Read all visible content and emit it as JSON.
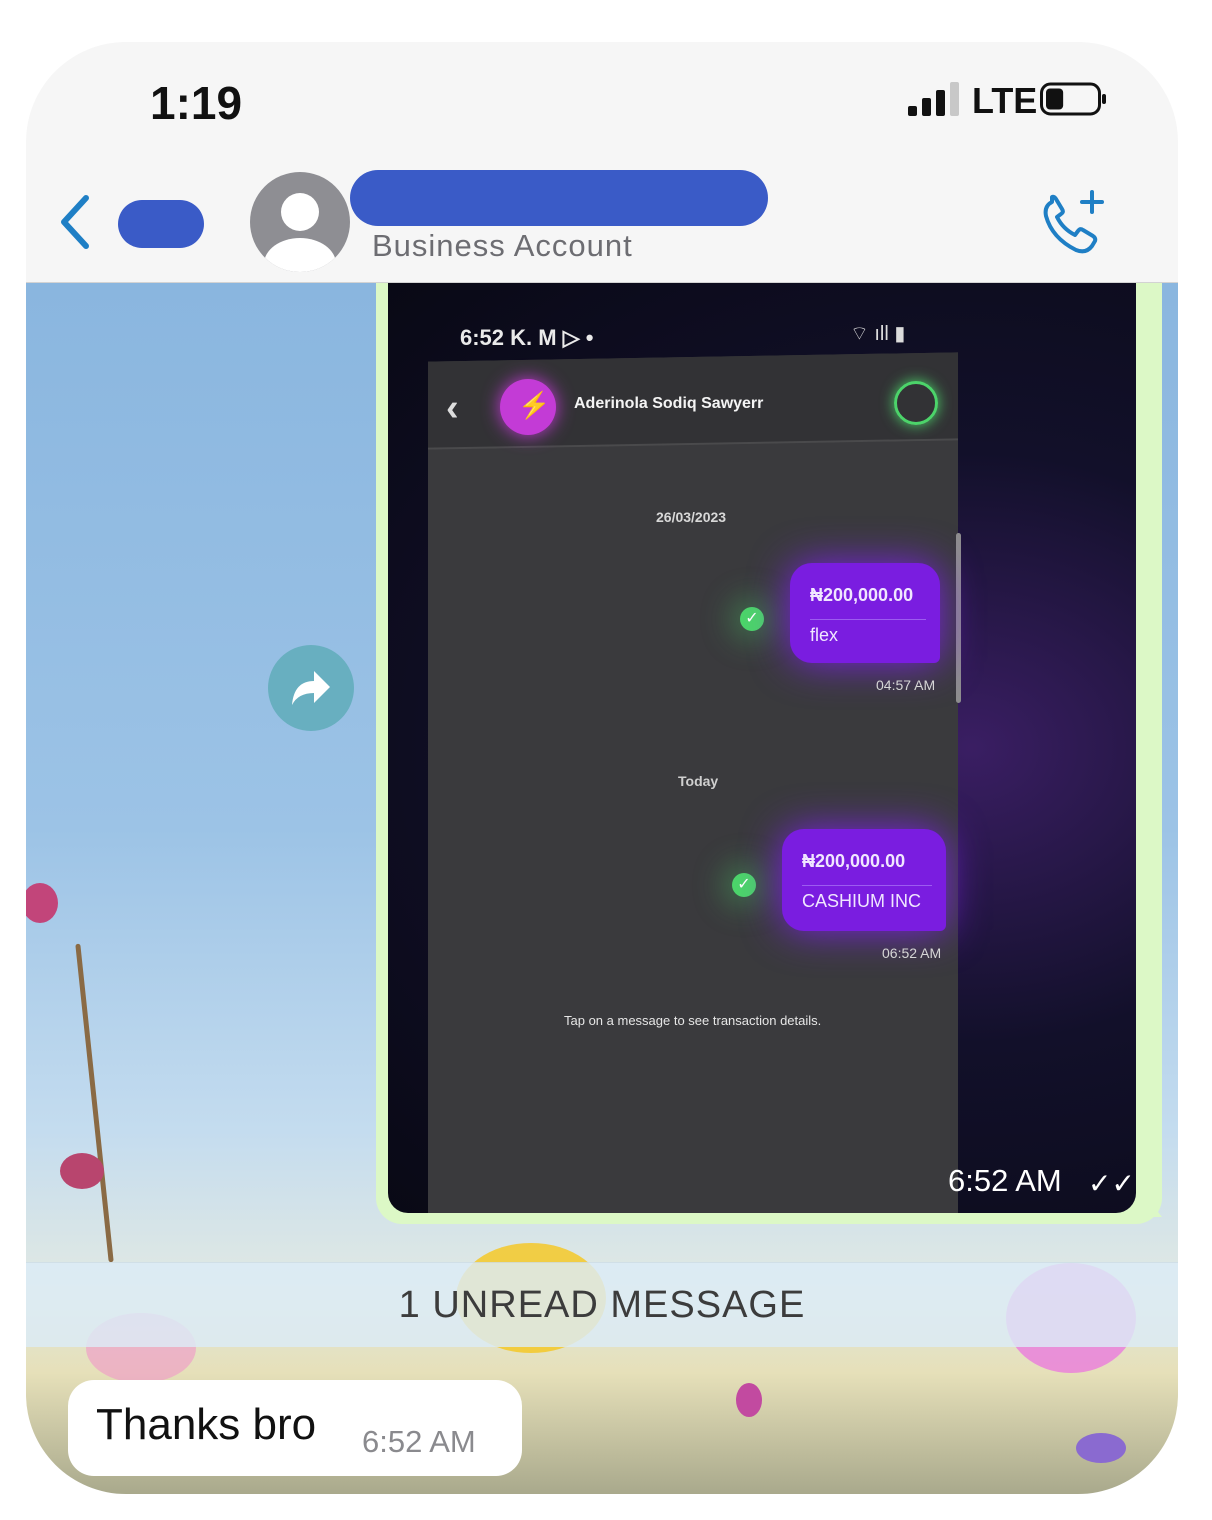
{
  "status_bar": {
    "time": "1:19",
    "network": "LTE",
    "signal_bars": 3,
    "battery_level": 0.35
  },
  "header": {
    "subtitle": "Business Account",
    "back_icon": "chevron-left-icon",
    "call_icon": "phone-add-icon"
  },
  "messages": {
    "image_message": {
      "time": "6:52 AM",
      "ticks": "✓✓",
      "screenshot": {
        "status_time": "6:52 K. M ▷ •",
        "contact": "Aderinola Sodiq Sawyerr",
        "date": "26/03/2023",
        "today": "Today",
        "hint": "Tap on a message to see transaction details.",
        "transactions": [
          {
            "amount": "₦200,000.00",
            "note": "flex",
            "time": "04:57 AM"
          },
          {
            "amount": "₦200,000.00",
            "note": "CASHIUM INC",
            "time": "06:52 AM"
          }
        ]
      }
    },
    "unread_banner": "1 UNREAD MESSAGE",
    "incoming": {
      "text": "Thanks bro",
      "time": "6:52 AM"
    }
  },
  "colors": {
    "accent": "#1f7fc5",
    "bubble_out": "#dcf8c6",
    "redaction": "#3a5bc7",
    "forward_button": "#68afc0"
  }
}
